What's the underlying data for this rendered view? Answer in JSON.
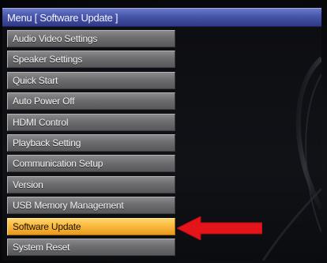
{
  "window": {
    "title": "Menu [ Software Update ]"
  },
  "menu": {
    "items": [
      {
        "label": "Audio Video Settings"
      },
      {
        "label": "Speaker Settings"
      },
      {
        "label": "Quick Start"
      },
      {
        "label": "Auto Power Off"
      },
      {
        "label": "HDMI Control"
      },
      {
        "label": "Playback Setting"
      },
      {
        "label": "Communication Setup"
      },
      {
        "label": "Version"
      },
      {
        "label": "USB Memory Management"
      },
      {
        "label": "Software Update",
        "selected": true
      },
      {
        "label": "System Reset"
      }
    ],
    "selected_index": 9
  },
  "colors": {
    "title_bar": "#4654a8",
    "item_background": "#6d6d70",
    "selected_background": "#f9b940",
    "annotation_arrow": "#e3151b"
  },
  "icons": {
    "annotation": "red-left-arrow"
  }
}
